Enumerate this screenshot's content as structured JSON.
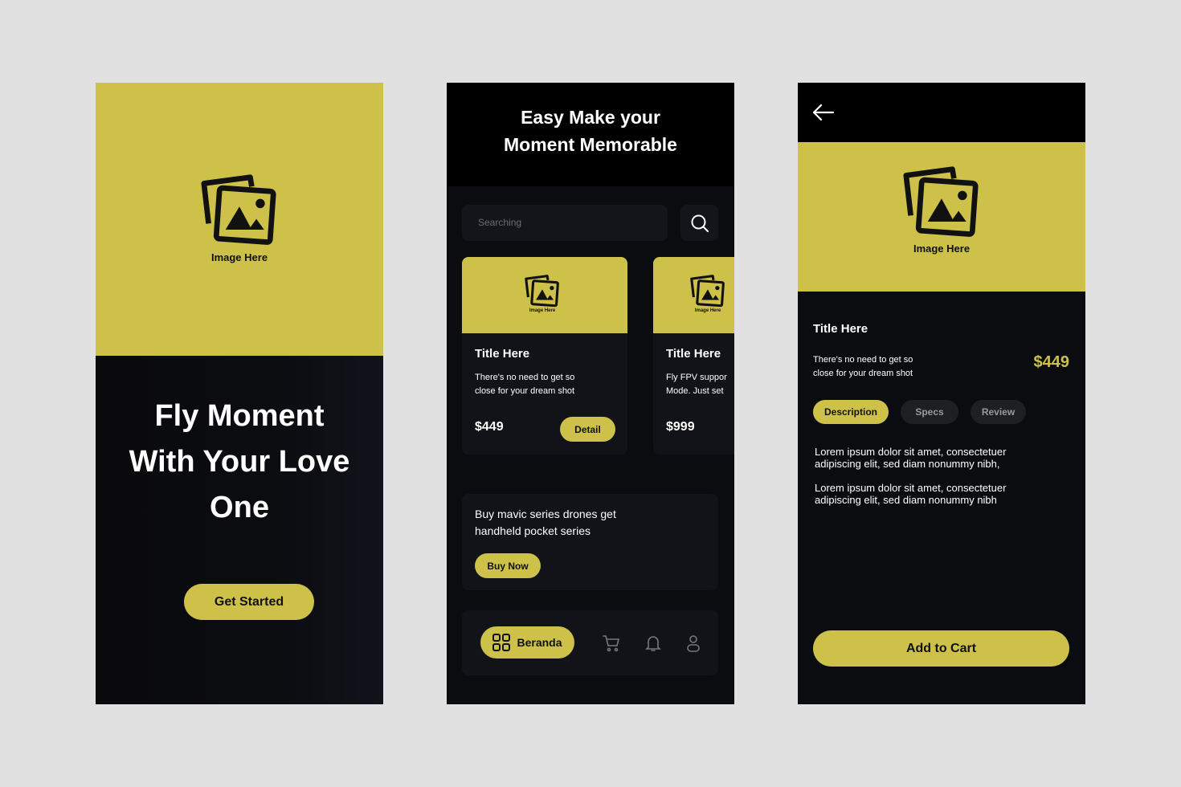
{
  "colors": {
    "accent": "#cdc14a",
    "background": "#e1e1e1",
    "phone_bg": "#0b0c10"
  },
  "screen1": {
    "image_label": "Image Here",
    "headline": [
      "Fly Moment",
      "With Your Love",
      "One"
    ],
    "cta": "Get Started"
  },
  "screen2": {
    "title": [
      "Easy Make your",
      "Moment Memorable"
    ],
    "search": {
      "placeholder": "Searching",
      "icon": "search-icon"
    },
    "cards": [
      {
        "image_label": "Image Here",
        "title": "Title Here",
        "desc": [
          "There's no need to get so",
          "close for your dream shot"
        ],
        "price": "$449",
        "button": "Detail"
      },
      {
        "image_label": "Image Here",
        "title": "Title Here",
        "desc": [
          "Fly FPV suppor",
          "Mode. Just set"
        ],
        "price": "$999"
      }
    ],
    "promo": {
      "text": [
        "Buy mavic series drones get",
        "handheld pocket series"
      ],
      "button": "Buy Now"
    },
    "nav": {
      "active": "Beranda",
      "icons": [
        "grid-icon",
        "cart-icon",
        "bell-icon",
        "user-icon"
      ]
    }
  },
  "screen3": {
    "image_label": "Image Here",
    "title": "Title Here",
    "desc": [
      "There's no need to get so",
      "close for your dream shot"
    ],
    "price": "$449",
    "tabs": [
      "Description",
      "Specs",
      "Review"
    ],
    "active_tab": "Description",
    "paragraphs": [
      [
        "Lorem ipsum dolor sit amet, consectetuer",
        "adipiscing elit, sed diam nonummy nibh,"
      ],
      [
        "Lorem ipsum dolor sit amet, consectetuer",
        "adipiscing elit, sed diam nonummy nibh"
      ]
    ],
    "cta": "Add to Cart"
  }
}
